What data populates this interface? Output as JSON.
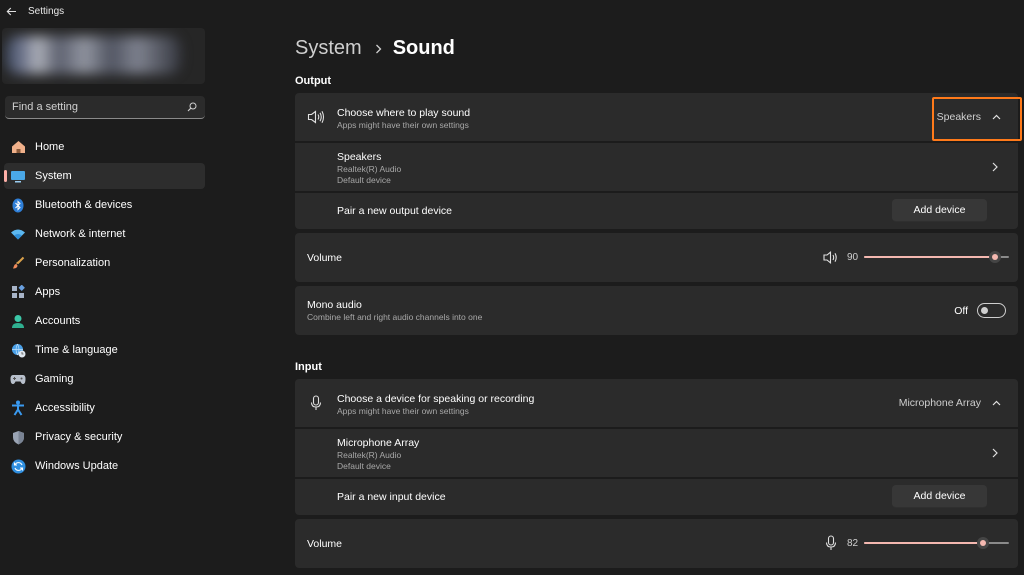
{
  "window": {
    "title": "Settings"
  },
  "sidebar": {
    "search": {
      "placeholder": "Find a setting"
    },
    "items": [
      {
        "label": "Home",
        "icon": "home-icon",
        "active": false
      },
      {
        "label": "System",
        "icon": "system-icon",
        "active": true
      },
      {
        "label": "Bluetooth & devices",
        "icon": "bluetooth-icon",
        "active": false
      },
      {
        "label": "Network & internet",
        "icon": "wifi-icon",
        "active": false
      },
      {
        "label": "Personalization",
        "icon": "brush-icon",
        "active": false
      },
      {
        "label": "Apps",
        "icon": "apps-icon",
        "active": false
      },
      {
        "label": "Accounts",
        "icon": "accounts-icon",
        "active": false
      },
      {
        "label": "Time & language",
        "icon": "globe-clock-icon",
        "active": false
      },
      {
        "label": "Gaming",
        "icon": "gamepad-icon",
        "active": false
      },
      {
        "label": "Accessibility",
        "icon": "accessibility-icon",
        "active": false
      },
      {
        "label": "Privacy & security",
        "icon": "shield-icon",
        "active": false
      },
      {
        "label": "Windows Update",
        "icon": "update-icon",
        "active": false
      }
    ]
  },
  "breadcrumb": {
    "parent": "System",
    "current": "Sound"
  },
  "output": {
    "section_label": "Output",
    "choose": {
      "title": "Choose where to play sound",
      "subtitle": "Apps might have their own settings",
      "selected": "Speakers"
    },
    "device": {
      "name": "Speakers",
      "driver": "Realtek(R) Audio",
      "status": "Default device"
    },
    "pair": {
      "label": "Pair a new output device",
      "button": "Add device"
    },
    "volume": {
      "label": "Volume",
      "value": "90",
      "level": 0.9
    },
    "mono": {
      "title": "Mono audio",
      "subtitle": "Combine left and right audio channels into one",
      "state": "Off"
    }
  },
  "input": {
    "section_label": "Input",
    "choose": {
      "title": "Choose a device for speaking or recording",
      "subtitle": "Apps might have their own settings",
      "selected": "Microphone Array"
    },
    "device": {
      "name": "Microphone Array",
      "driver": "Realtek(R) Audio",
      "status": "Default device"
    },
    "pair": {
      "label": "Pair a new input device",
      "button": "Add device"
    },
    "volume": {
      "label": "Volume",
      "value": "82",
      "level": 0.82
    }
  },
  "colors": {
    "accent": "#f4b8b0",
    "highlight": "#ff7a1a",
    "background": "#1c1c1c",
    "card": "#2b2b2b"
  }
}
